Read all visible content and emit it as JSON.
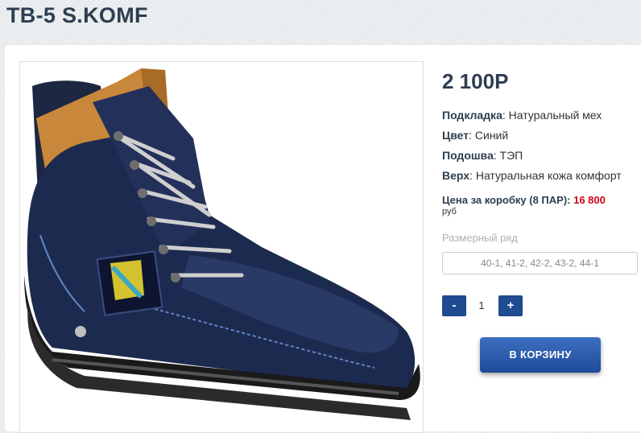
{
  "product": {
    "title": "ТВ-5 S.KOMF",
    "price": "2 100Р",
    "specs": [
      {
        "label": "Подкладка",
        "value": "Натуральный мех"
      },
      {
        "label": "Цвет",
        "value": "Синий"
      },
      {
        "label": "Подошва",
        "value": "ТЭП"
      },
      {
        "label": "Верх",
        "value": "Натуральная кожа комфорт"
      }
    ],
    "box_price": {
      "label": "Цена за коробку (8 ПАР):",
      "value": "16 800",
      "currency": "руб"
    },
    "size_range": {
      "label": "Размерный ряд",
      "value": "40-1, 41-2, 42-2, 43-2, 44-1"
    },
    "quantity": {
      "minus": "-",
      "value": "1",
      "plus": "+"
    },
    "cart_button": "В КОРЗИНУ",
    "image_icon": "winter-boot-photo",
    "colors": {
      "title": "#2d3e50",
      "accent_button": "#1f4b8f",
      "price_highlight": "#d0021b"
    }
  }
}
